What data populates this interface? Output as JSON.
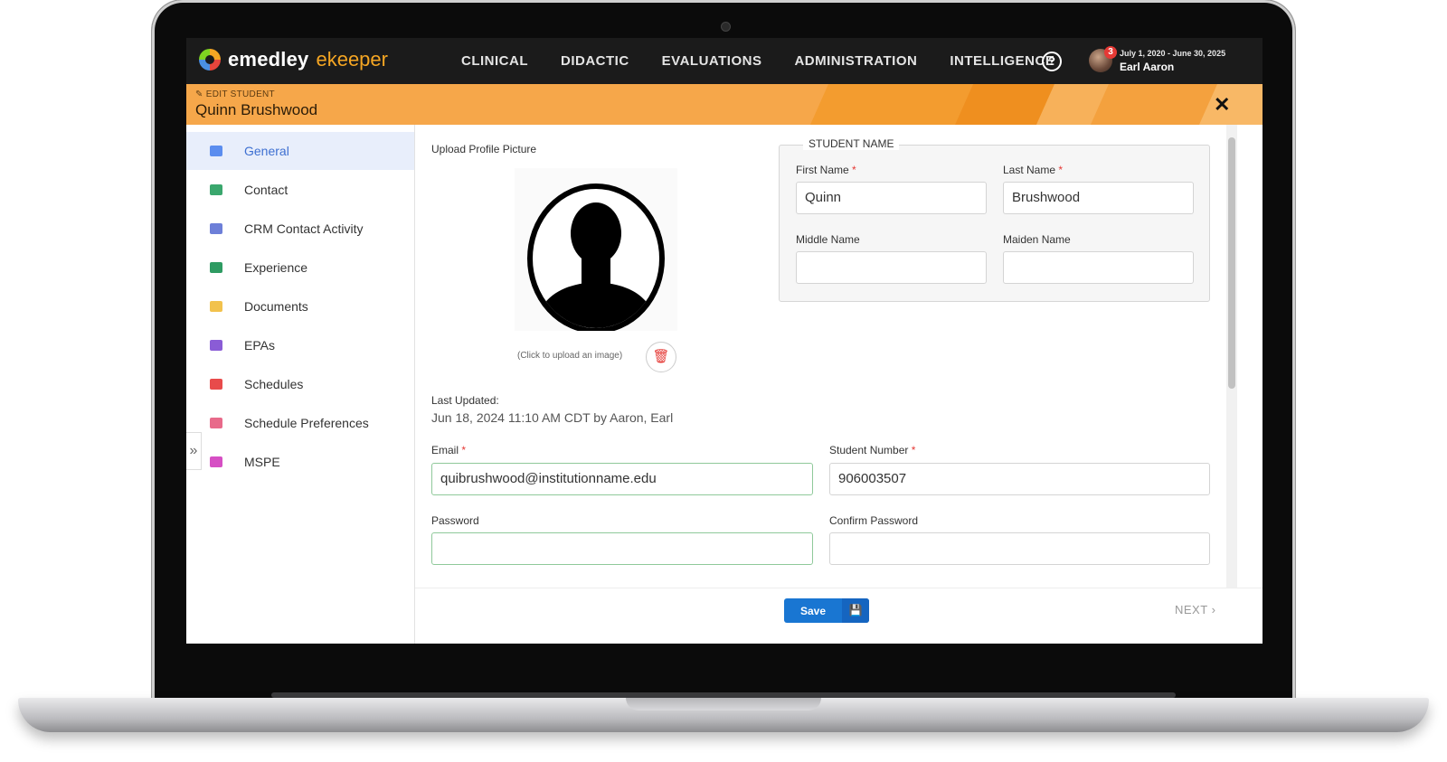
{
  "app": {
    "brand_primary": "emedley",
    "brand_secondary": "ekeeper",
    "nav": [
      "CLINICAL",
      "DIDACTIC",
      "EVALUATIONS",
      "ADMINISTRATION",
      "INTELLIGENCE"
    ],
    "help_icon": "?",
    "notification_count": "3",
    "date_range": "July 1, 2020 - June 30, 2025",
    "user_name": "Earl Aaron"
  },
  "banner": {
    "mode_label": "EDIT STUDENT",
    "student_name": "Quinn Brushwood",
    "close_icon": "✕"
  },
  "sidebar": {
    "items": [
      {
        "label": "General",
        "icon": "id-card-icon",
        "color": "#5b8def",
        "active": true
      },
      {
        "label": "Contact",
        "icon": "contact-card-icon",
        "color": "#3aa76d"
      },
      {
        "label": "CRM Contact Activity",
        "icon": "envelope-icon",
        "color": "#6d7fd8"
      },
      {
        "label": "Experience",
        "icon": "books-icon",
        "color": "#2e9b62"
      },
      {
        "label": "Documents",
        "icon": "document-icon",
        "color": "#f2c24d"
      },
      {
        "label": "EPAs",
        "icon": "clipboard-icon",
        "color": "#8a5cd6"
      },
      {
        "label": "Schedules",
        "icon": "calendar-icon",
        "color": "#e84b4b"
      },
      {
        "label": "Schedule Preferences",
        "icon": "list-icon",
        "color": "#e86a8a"
      },
      {
        "label": "MSPE",
        "icon": "report-icon",
        "color": "#d64fc4"
      }
    ],
    "expand_icon": "»"
  },
  "profile": {
    "upload_title": "Upload Profile Picture",
    "upload_hint": "(Click to upload an image)",
    "delete_icon": "🗑",
    "last_updated_label": "Last Updated:",
    "last_updated_value": "Jun 18, 2024 11:10 AM CDT by Aaron, Earl"
  },
  "student_name_section": {
    "legend": "STUDENT NAME",
    "first_name_label": "First Name",
    "first_name_value": "Quinn",
    "last_name_label": "Last Name",
    "last_name_value": "Brushwood",
    "middle_name_label": "Middle Name",
    "middle_name_value": "",
    "maiden_name_label": "Maiden Name",
    "maiden_name_value": ""
  },
  "account": {
    "email_label": "Email",
    "email_value": "quibrushwood@institutionname.edu",
    "student_number_label": "Student Number",
    "student_number_value": "906003507",
    "password_label": "Password",
    "password_value": "",
    "confirm_password_label": "Confirm Password",
    "confirm_password_value": ""
  },
  "required_marker": "*",
  "footer": {
    "save_label": "Save",
    "save_icon": "💾",
    "next_label": "NEXT",
    "next_icon": "›"
  },
  "colors": {
    "accent_orange": "#f6a74a",
    "nav_bg": "#1b1b1b",
    "primary_blue": "#1976d2",
    "required_red": "#e53935"
  }
}
